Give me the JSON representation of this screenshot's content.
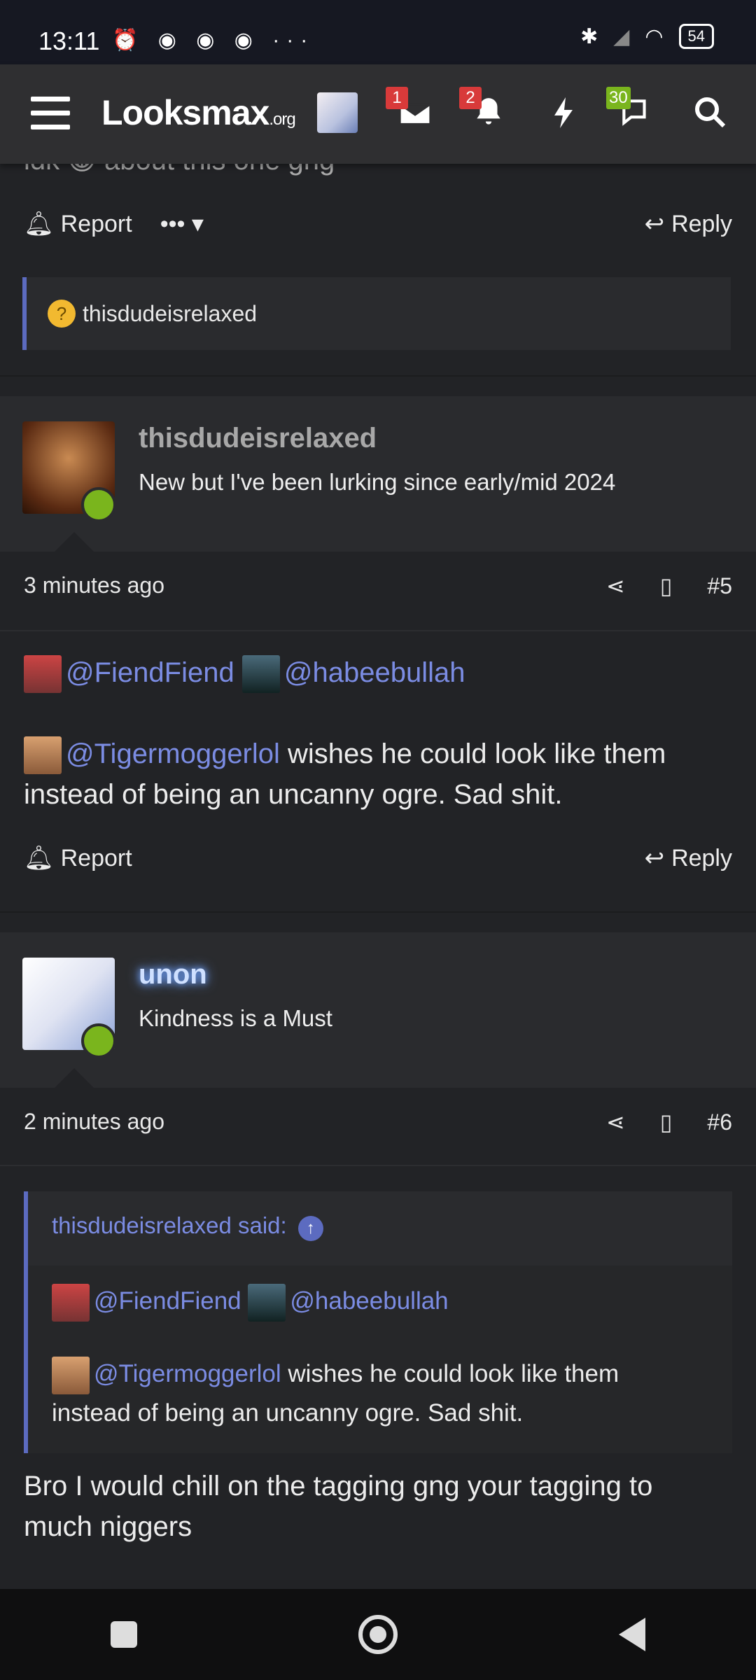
{
  "status_bar": {
    "time": "13:11",
    "left_icons": "⏰ ◉ ◉ ◉ ···",
    "right_icons": [
      "bluetooth-icon",
      "signal-icon",
      "wifi-icon"
    ],
    "battery": "54"
  },
  "nav": {
    "logo": "Looksmax",
    "logo_suffix": ".org",
    "inbox_badge": "1",
    "alerts_badge": "2",
    "chat_badge": "30"
  },
  "post4": {
    "snippet": "idk 😀 about this one gng",
    "report_label": "Report",
    "more_label": "•••",
    "reply_label": "Reply",
    "reaction_user": "thisdudeisrelaxed"
  },
  "post5": {
    "username": "thisdudeisrelaxed",
    "usertitle": "New but I've been lurking since early/mid 2024",
    "time": "3 minutes ago",
    "post_number": "#5",
    "mention1": "@FiendFiend",
    "mention2": "@habeebullah",
    "mention3": "@Tigermoggerlol",
    "body_rest": " wishes he could look like them instead of being an uncanny ogre. Sad shit.",
    "report_label": "Report",
    "reply_label": "Reply"
  },
  "post6": {
    "username": "unon",
    "usertitle": "Kindness is a Must",
    "time": "2 minutes ago",
    "post_number": "#6",
    "quote_header": "thisdudeisrelaxed said:",
    "quote_mention1": "@FiendFiend",
    "quote_mention2": "@habeebullah",
    "quote_mention3": "@Tigermoggerlol",
    "quote_rest": " wishes he could look like them instead of being an uncanny ogre. Sad shit.",
    "reply_body": "Bro I would chill on the tagging gng your tagging to much niggers"
  },
  "colors": {
    "accent": "#5c6bc0",
    "mention": "#7b8ce3",
    "online": "#7ab51d",
    "badge_red": "#d83a3a",
    "badge_green": "#7ab51d"
  }
}
